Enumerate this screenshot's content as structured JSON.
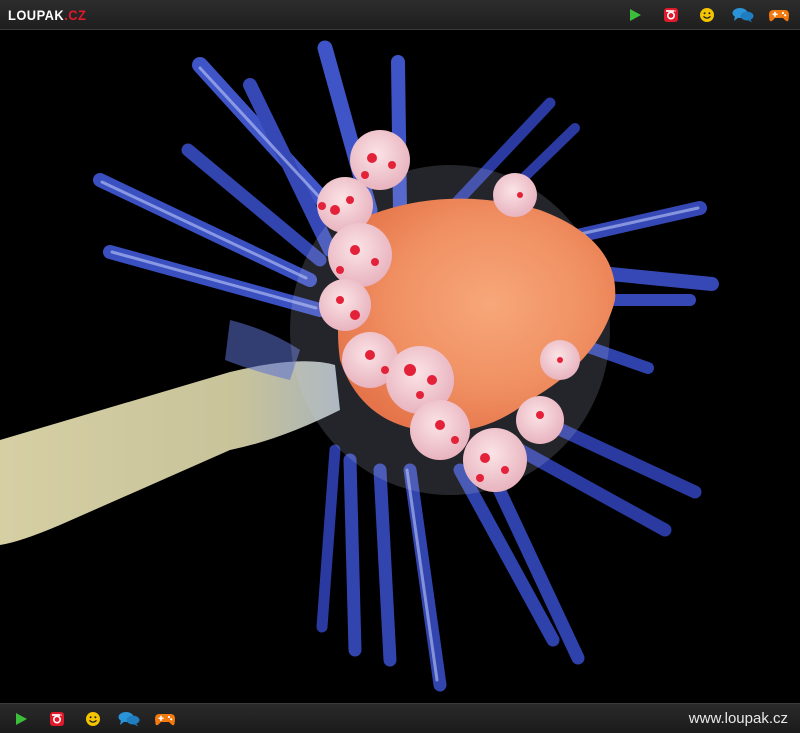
{
  "header": {
    "logo": {
      "main": "LOUPAK",
      "tld": ".CZ"
    },
    "icons": [
      "play-icon",
      "instagram-icon",
      "smiley-icon",
      "chat-icon",
      "gamepad-icon"
    ]
  },
  "footer": {
    "icons": [
      "play-icon",
      "instagram-icon",
      "smiley-icon",
      "chat-icon",
      "gamepad-icon"
    ],
    "site_url": "www.loupak.cz"
  },
  "colors": {
    "bar_bg": "#252525",
    "logo_accent": "#e0192b",
    "play": "#3bbf3b",
    "instagram": "#e0192b",
    "smiley": "#f5c400",
    "chat": "#2b93d8",
    "gamepad": "#f07a10"
  }
}
